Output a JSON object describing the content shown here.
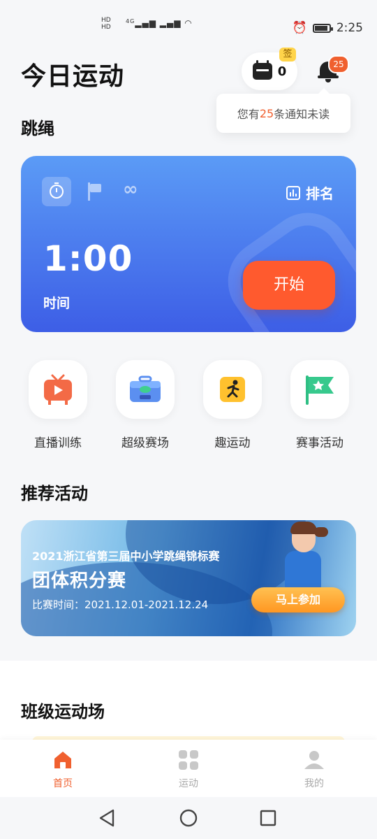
{
  "status_bar": {
    "left_indicators": [
      "HD",
      "HD"
    ],
    "network": "4G",
    "time": "2:25"
  },
  "header": {
    "title": "今日运动",
    "signin_count": "0",
    "signin_badge": "签",
    "notification_badge": "25",
    "tooltip_prefix": "您有",
    "tooltip_count": "25",
    "tooltip_suffix": "条通知未读"
  },
  "rope_section": {
    "title": "跳绳",
    "rank_label": "排名",
    "infinite_symbol": "∞",
    "timer_value": "1:00",
    "timer_label": "时间",
    "start_label": "开始"
  },
  "quick_entries": [
    {
      "label": "直播训练",
      "icon": "tv-icon"
    },
    {
      "label": "超级赛场",
      "icon": "toolbox-icon"
    },
    {
      "label": "趣运动",
      "icon": "runner-icon"
    },
    {
      "label": "赛事活动",
      "icon": "flag-icon"
    }
  ],
  "recommend": {
    "title": "推荐活动",
    "subtitle": "2021浙江省第三届中小学跳绳锦标赛",
    "headline": "团体积分赛",
    "date": "比赛时间：2021.12.01-2021.12.24",
    "button": "马上参加"
  },
  "class_section": {
    "title": "班级运动场"
  },
  "tabs": [
    {
      "label": "首页",
      "active": true
    },
    {
      "label": "运动",
      "active": false
    },
    {
      "label": "我的",
      "active": false
    }
  ],
  "colors": {
    "accent": "#f0602f",
    "card_blue_top": "#5b9bf6",
    "card_blue_bottom": "#3d5ee6",
    "start_button": "#ff5a2e"
  }
}
